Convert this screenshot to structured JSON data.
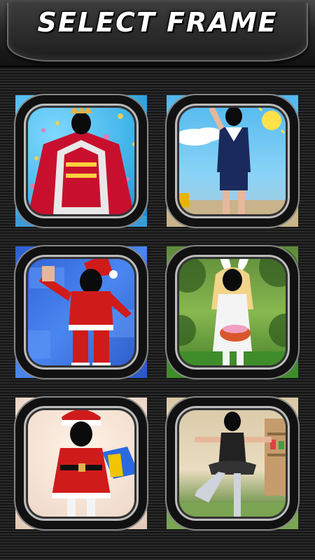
{
  "header": {
    "title": "SELECT FRAME"
  },
  "frames": [
    {
      "name": "king"
    },
    {
      "name": "sailor"
    },
    {
      "name": "santa-boy"
    },
    {
      "name": "bunny-girl"
    },
    {
      "name": "santa-girl"
    },
    {
      "name": "ballerina"
    }
  ],
  "colors": {
    "background": "#1e1e1e",
    "header": "#2a2a2a",
    "title": "#ffffff"
  }
}
